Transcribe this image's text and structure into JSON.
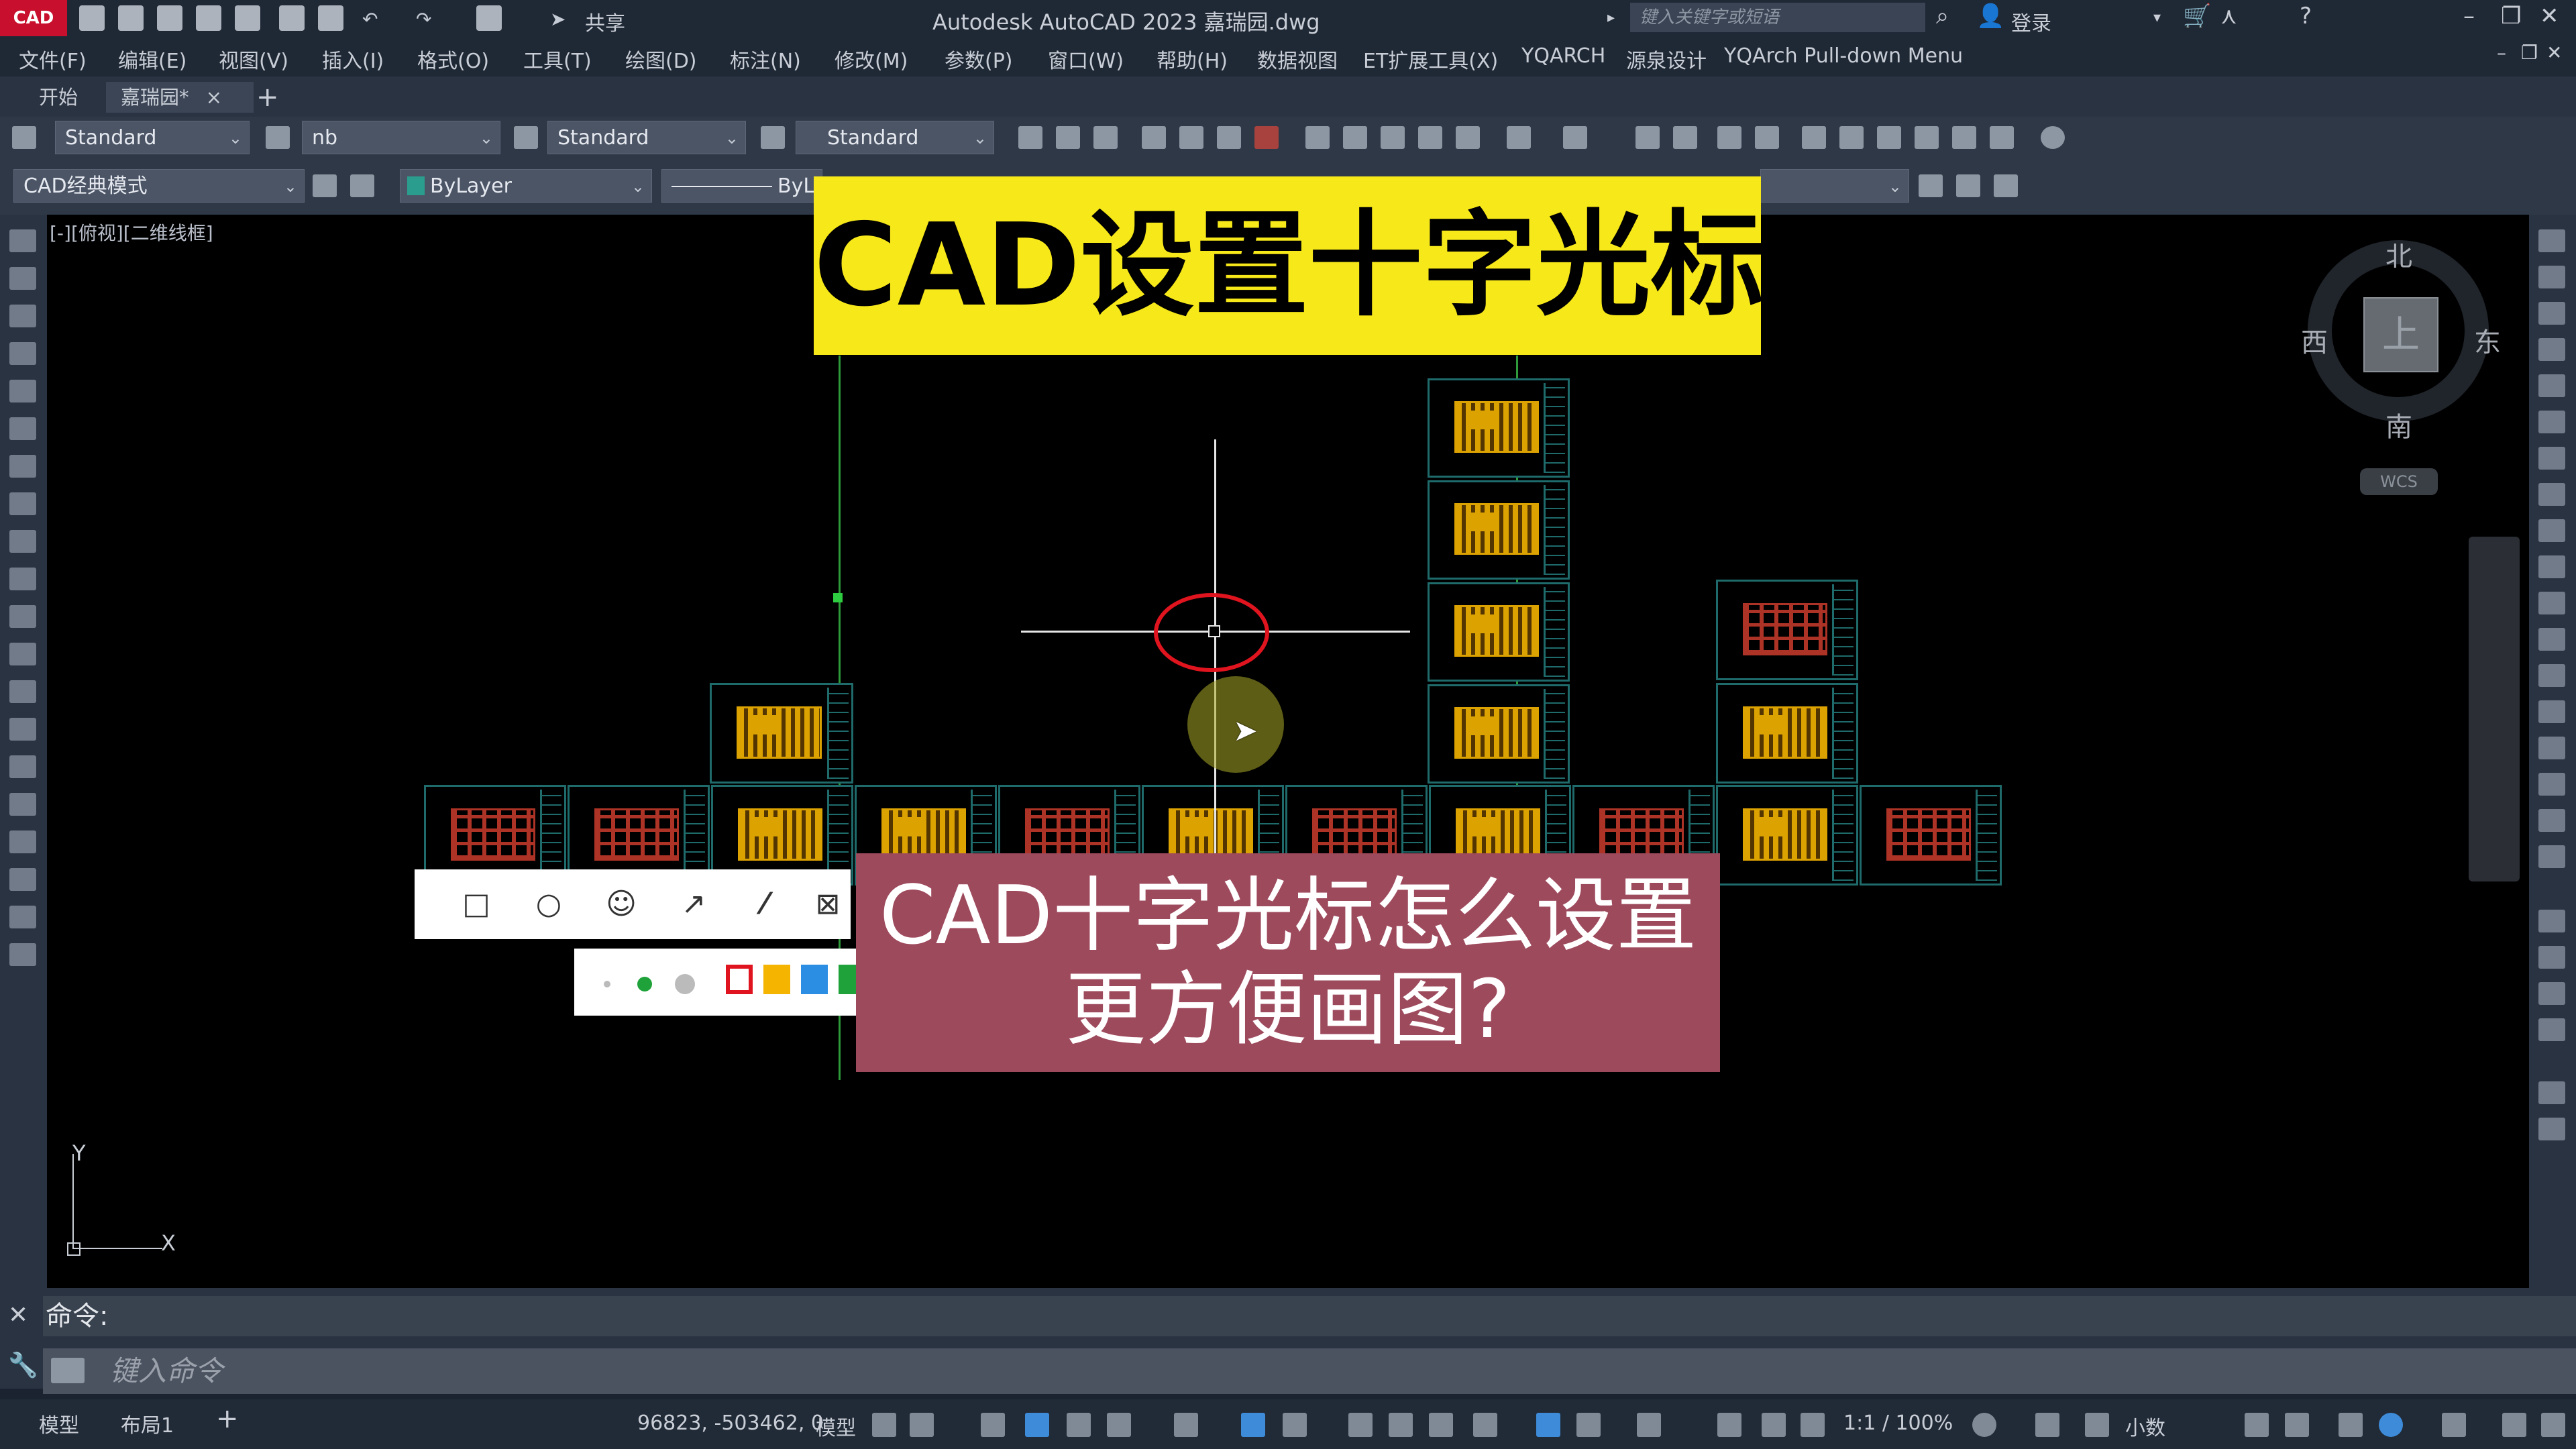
{
  "titlebar": {
    "logo": "CAD",
    "share_label": "共享",
    "window_title": "Autodesk AutoCAD 2023    嘉瑞园.dwg",
    "search_placeholder": "键入关键字或短语",
    "login_label": "登录"
  },
  "menubar": {
    "items": [
      "文件(F)",
      "编辑(E)",
      "视图(V)",
      "插入(I)",
      "格式(O)",
      "工具(T)",
      "绘图(D)",
      "标注(N)",
      "修改(M)",
      "参数(P)",
      "窗口(W)",
      "帮助(H)",
      "数据视图",
      "ET扩展工具(X)",
      "YQARCH",
      "源泉设计",
      "YQArch Pull-down Menu"
    ]
  },
  "tabs": {
    "start": "开始",
    "drawing": "嘉瑞园*",
    "close": "×",
    "add": "+"
  },
  "toolbar1": {
    "text_style": "Standard",
    "dim_style": "nb",
    "table_style": "Standard",
    "multileader_style": "Standard"
  },
  "toolbar2": {
    "workspace": "CAD经典模式",
    "layer": "ByLayer",
    "linetype": "ByL"
  },
  "canvas": {
    "viewport_label": "[-][俯视][二维线框]",
    "ucs_y": "Y",
    "ucs_x": "X"
  },
  "banners": {
    "title": "CAD设置十字光标",
    "subtitle_line1": "CAD十字光标怎么设置",
    "subtitle_line2": "更方便画图?"
  },
  "compass": {
    "north": "北",
    "south": "南",
    "east": "东",
    "west": "西",
    "face": "上",
    "wcs": "WCS"
  },
  "command": {
    "history": "命令:",
    "placeholder": "键入命令"
  },
  "statusbar": {
    "model_tab": "模型",
    "layout_tab": "布局1",
    "add": "+",
    "coords": "96823, -503462, 0",
    "model_label": "模型",
    "scale": "1:1 / 100%",
    "units": "小数"
  },
  "colors": {
    "banner_yellow": "#f7e81a",
    "banner_red": "#9e4a5d",
    "canvas": "#000000",
    "sheet_border": "#1f6b6b",
    "annotation_red": "#e0141e"
  }
}
